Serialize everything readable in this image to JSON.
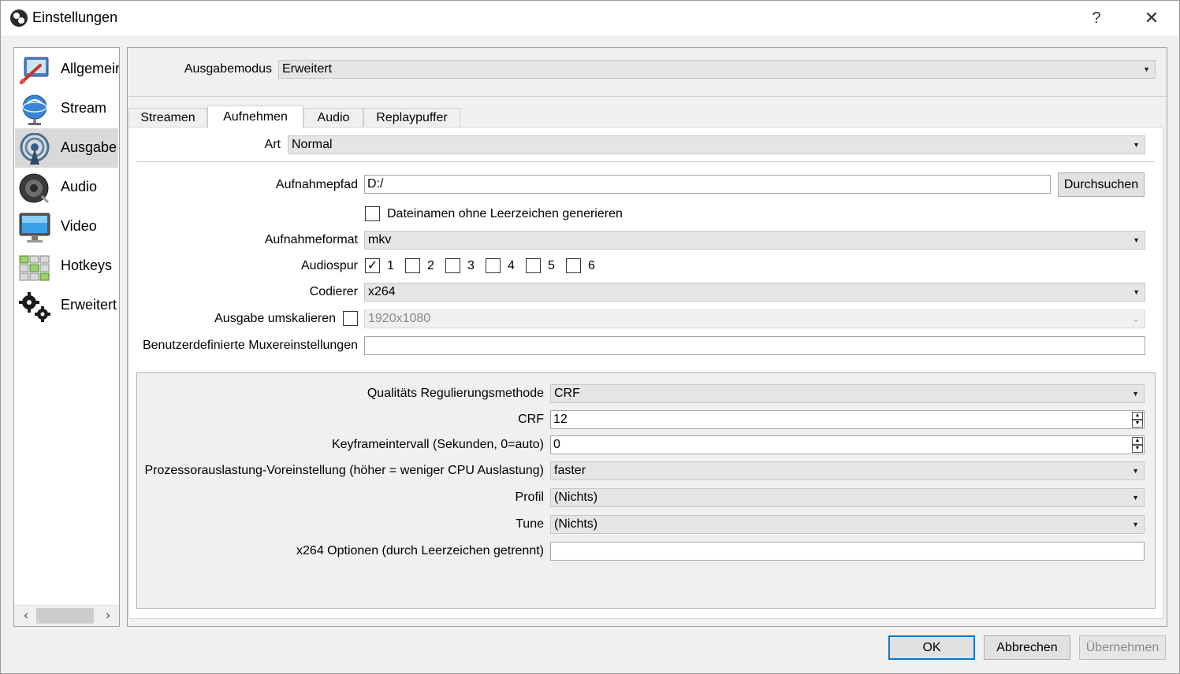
{
  "window": {
    "title": "Einstellungen",
    "help_label": "?",
    "close_label": "✕"
  },
  "sidebar": {
    "items": [
      {
        "label": "Allgemein",
        "icon": "general-icon"
      },
      {
        "label": "Stream",
        "icon": "stream-globe-icon"
      },
      {
        "label": "Ausgabe",
        "icon": "output-broadcast-icon",
        "selected": true
      },
      {
        "label": "Audio",
        "icon": "speaker-icon"
      },
      {
        "label": "Video",
        "icon": "monitor-icon"
      },
      {
        "label": "Hotkeys",
        "icon": "hotkeys-icon"
      },
      {
        "label": "Erweitert",
        "icon": "gears-icon"
      }
    ],
    "scroll_left": "‹",
    "scroll_right": "›"
  },
  "output": {
    "mode_label": "Ausgabemodus",
    "mode_value": "Erweitert",
    "tabs": [
      {
        "label": "Streamen"
      },
      {
        "label": "Aufnehmen",
        "active": true
      },
      {
        "label": "Audio"
      },
      {
        "label": "Replaypuffer"
      }
    ],
    "type_label": "Art",
    "type_value": "Normal",
    "path_label": "Aufnahmepfad",
    "path_value": "D:/",
    "browse_label": "Durchsuchen",
    "no_spaces_label": "Dateinamen ohne Leerzeichen generieren",
    "no_spaces_checked": false,
    "format_label": "Aufnahmeformat",
    "format_value": "mkv",
    "audio_track_label": "Audiospur",
    "audio_tracks": [
      {
        "label": "1",
        "checked": true
      },
      {
        "label": "2",
        "checked": false
      },
      {
        "label": "3",
        "checked": false
      },
      {
        "label": "4",
        "checked": false
      },
      {
        "label": "5",
        "checked": false
      },
      {
        "label": "6",
        "checked": false
      }
    ],
    "encoder_label": "Codierer",
    "encoder_value": "x264",
    "rescale_label": "Ausgabe umskalieren",
    "rescale_checked": false,
    "rescale_value": "1920x1080",
    "mux_label": "Benutzerdefinierte Muxereinstellungen",
    "mux_value": ""
  },
  "encoder": {
    "rate_control_label": "Qualitäts Regulierungsmethode",
    "rate_control_value": "CRF",
    "crf_label": "CRF",
    "crf_value": "12",
    "keyframe_label": "Keyframeintervall (Sekunden, 0=auto)",
    "keyframe_value": "0",
    "preset_label": "Prozessorauslastung-Voreinstellung (höher = weniger CPU Auslastung)",
    "preset_value": "faster",
    "profile_label": "Profil",
    "profile_value": "(Nichts)",
    "tune_label": "Tune",
    "tune_value": "(Nichts)",
    "options_label": "x264 Optionen (durch Leerzeichen getrennt)",
    "options_value": ""
  },
  "footer": {
    "ok_label": "OK",
    "cancel_label": "Abbrechen",
    "apply_label": "Übernehmen"
  },
  "symbols": {
    "check": "✓",
    "dropdown_arrow": "▼",
    "disabled_arrow": "⌄",
    "spin_up": "▲",
    "spin_down": "▼"
  }
}
